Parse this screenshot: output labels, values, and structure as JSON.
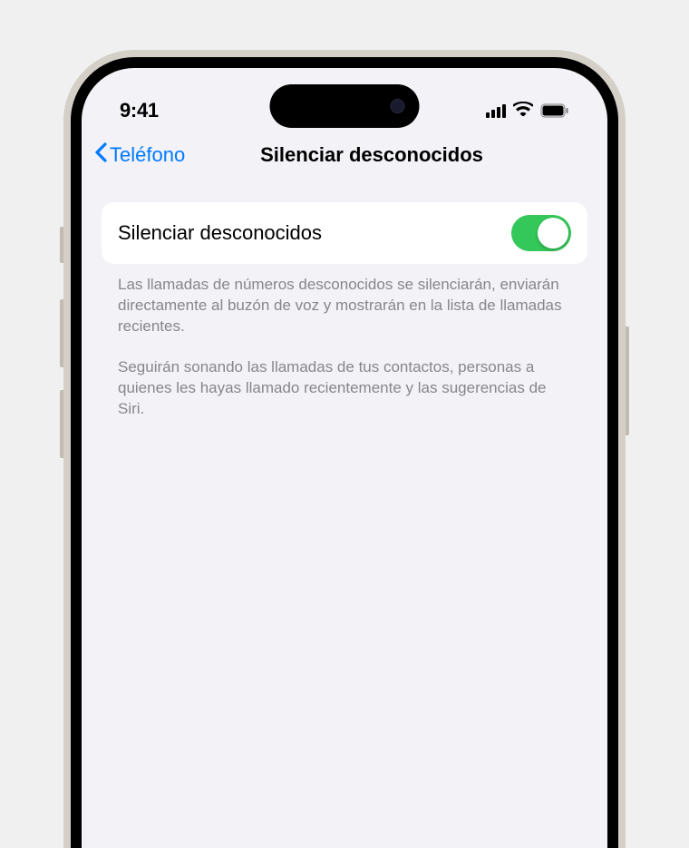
{
  "statusBar": {
    "time": "9:41"
  },
  "navBar": {
    "backLabel": "Teléfono",
    "title": "Silenciar desconocidos"
  },
  "settings": {
    "row": {
      "label": "Silenciar desconocidos",
      "enabled": true
    },
    "footer": {
      "paragraph1": "Las llamadas de números desconocidos se silenciarán, enviarán directamente al buzón de voz y mostrarán en la lista de llamadas recientes.",
      "paragraph2": "Seguirán sonando las llamadas de tus contactos, personas a quienes les hayas llamado recientemente y las sugerencias de Siri."
    }
  }
}
